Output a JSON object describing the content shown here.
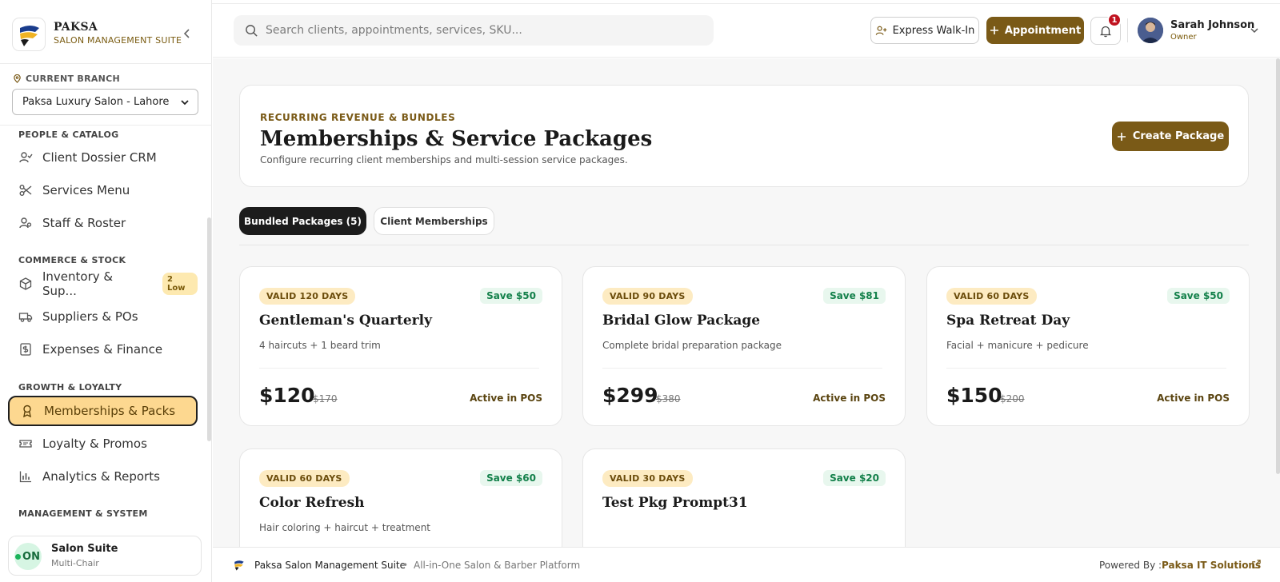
{
  "brand": {
    "name": "PAKSA",
    "subtitle": "SALON MANAGEMENT SUITE"
  },
  "branch": {
    "label": "CURRENT BRANCH",
    "selected": "Paksa Luxury Salon - Lahore"
  },
  "sidebar": {
    "sections": [
      {
        "title": "PEOPLE & CATALOG"
      },
      {
        "title": "COMMERCE & STOCK"
      },
      {
        "title": "GROWTH & LOYALTY"
      },
      {
        "title": "MANAGEMENT & SYSTEM"
      }
    ],
    "items": [
      {
        "label": "Client Dossier CRM",
        "icon": "user-check-icon"
      },
      {
        "label": "Services Menu",
        "icon": "scissors-icon"
      },
      {
        "label": "Staff & Roster",
        "icon": "users-icon"
      },
      {
        "label": "Inventory & Sup...",
        "icon": "package-icon",
        "badge": "2 Low"
      },
      {
        "label": "Suppliers & POs",
        "icon": "truck-icon"
      },
      {
        "label": "Expenses & Finance",
        "icon": "receipt-icon"
      },
      {
        "label": "Memberships & Packs",
        "icon": "award-icon",
        "active": true
      },
      {
        "label": "Loyalty & Promos",
        "icon": "ticket-icon"
      },
      {
        "label": "Analytics & Reports",
        "icon": "bar-chart-icon"
      }
    ],
    "footer": {
      "badge": "ON",
      "title": "Salon Suite",
      "subtitle": "Multi-Chair"
    }
  },
  "topbar": {
    "search_placeholder": "Search clients, appointments, services, SKU...",
    "walkin_label": "Express Walk-In",
    "appointment_label": "Appointment",
    "notifications_count": "1",
    "user": {
      "name": "Sarah Johnson",
      "role": "Owner"
    }
  },
  "hero": {
    "kicker": "RECURRING REVENUE & BUNDLES",
    "title": "Memberships & Service Packages",
    "description": "Configure recurring client memberships and multi-session service packages.",
    "create_label": "Create Package"
  },
  "tabs": [
    {
      "label": "Bundled Packages (5)",
      "active": true
    },
    {
      "label": "Client Memberships",
      "active": false
    }
  ],
  "packages": [
    {
      "validity": "VALID 120 DAYS",
      "save": "Save $50",
      "name": "Gentleman's Quarterly",
      "description": "4 haircuts + 1 beard trim",
      "price": "$120",
      "original": "$170",
      "status": "Active in POS"
    },
    {
      "validity": "VALID 90 DAYS",
      "save": "Save $81",
      "name": "Bridal Glow Package",
      "description": "Complete bridal preparation package",
      "price": "$299",
      "original": "$380",
      "status": "Active in POS"
    },
    {
      "validity": "VALID 60 DAYS",
      "save": "Save $50",
      "name": "Spa Retreat Day",
      "description": "Facial + manicure + pedicure",
      "price": "$150",
      "original": "$200",
      "status": "Active in POS"
    },
    {
      "validity": "VALID 60 DAYS",
      "save": "Save $60",
      "name": "Color Refresh",
      "description": "Hair coloring + haircut + treatment",
      "price": "",
      "original": "",
      "status": ""
    },
    {
      "validity": "VALID 30 DAYS",
      "save": "Save $20",
      "name": "Test Pkg Prompt31",
      "description": "",
      "price": "",
      "original": "",
      "status": ""
    }
  ],
  "footer": {
    "product": "Paksa Salon Management Suite",
    "separator": "•",
    "tagline": "All-in-One Salon & Barber Platform",
    "powered_label": "Powered By :",
    "company": "Paksa IT Solutions"
  },
  "colors": {
    "accent": "#7a5a17",
    "active_nav": "#fdd890",
    "badge_bg": "#fdebc2",
    "save_green": "#13804a"
  }
}
